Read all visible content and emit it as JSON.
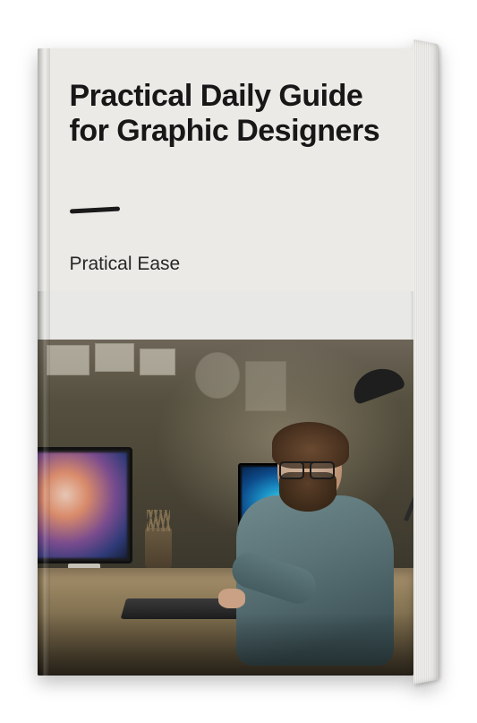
{
  "book": {
    "title": "Practical Daily Guide for Graphic Designers",
    "author": "Pratical Ease"
  }
}
